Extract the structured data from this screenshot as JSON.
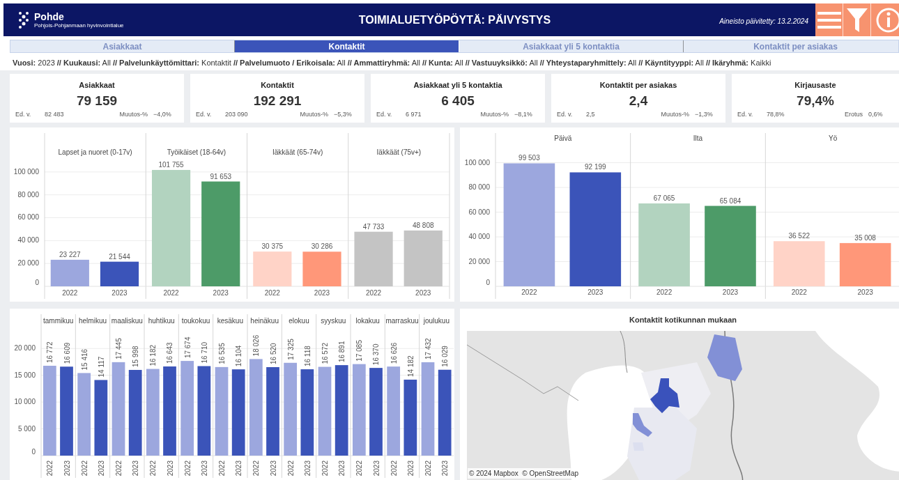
{
  "header": {
    "logo_text": "Pohde",
    "logo_subtitle": "Pohjois-Pohjanmaan hyvinvointialue",
    "title": "TOIMIALUETYÖPÖYTÄ: PÄIVYSTYS",
    "updated": "Aineisto päivitetty: 13.2.2024"
  },
  "tabs": [
    {
      "label": "Asiakkaat",
      "selected": false
    },
    {
      "label": "Kontaktit",
      "selected": true
    },
    {
      "label": "Asiakkaat yli 5 kontaktia",
      "selected": false
    },
    {
      "label": "Kontaktit per asiakas",
      "selected": false
    }
  ],
  "filters": "**Vuosi:** 2023 **// Kuukausi:** All **// Palvelunkäyttömittari:** Kontaktit **// Palvelumuoto / Erikoisala:** All **// Ammattiryhmä:** All **// Kunta:** All **// Vastuuyksikkö:** All **// Yhteystaparyhmittely:** All **// Käyntityyppi:** All **// Ikäryhmä:** Kaikki",
  "kpis": [
    {
      "title": "Asiakkaat",
      "value": "79 159",
      "prev_label": "Ed. v.",
      "prev_value": "82 483",
      "change_label": "Muutos-%",
      "change_value": "−4,0%"
    },
    {
      "title": "Kontaktit",
      "value": "192 291",
      "prev_label": "Ed. v.",
      "prev_value": "203 090",
      "change_label": "Muutos-%",
      "change_value": "−5,3%"
    },
    {
      "title": "Asiakkaat yli 5 kontaktia",
      "value": "6 405",
      "prev_label": "Ed. v.",
      "prev_value": "6 971",
      "change_label": "Muutos-%",
      "change_value": "−8,1%"
    },
    {
      "title": "Kontaktit per asiakas",
      "value": "2,4",
      "prev_label": "Ed. v.",
      "prev_value": "2,5",
      "change_label": "Muutos-%",
      "change_value": "−1,3%"
    },
    {
      "title": "Kirjausaste",
      "value": "79,4%",
      "prev_label": "Ed. v.",
      "prev_value": "78,8%",
      "change_label": "Erotus",
      "change_value": "0,6%"
    }
  ],
  "age_chart": {
    "chart_data": {
      "type": "bar",
      "categories": [
        "Lapset ja nuoret (0-17v)",
        "Työikäiset (18-64v)",
        "Iäkkäät (65-74v)",
        "Iäkkäät (75v+)"
      ],
      "series": [
        {
          "name": "2022",
          "colors": [
            "#9ca7de",
            "#b2d3bf",
            "#ffd3c7",
            "#c4c4c4"
          ],
          "values": [
            23227,
            101755,
            30375,
            47733
          ]
        },
        {
          "name": "2023",
          "colors": [
            "#3b54b9",
            "#4d9b68",
            "#ff9779",
            "#c4c4c4"
          ],
          "values": [
            21544,
            91653,
            30286,
            48808
          ]
        }
      ],
      "grid": true,
      "ylim": [
        0,
        134000
      ],
      "yticks": [
        {
          "value": 0,
          "label": "0"
        },
        {
          "value": 20000,
          "label": "20 000"
        },
        {
          "value": 40000,
          "label": "40 000"
        },
        {
          "value": 60000,
          "label": "60 000"
        },
        {
          "value": 80000,
          "label": "80 000"
        },
        {
          "value": 100000,
          "label": "100 000"
        }
      ],
      "data_labels": true
    }
  },
  "time_chart": {
    "chart_data": {
      "type": "bar",
      "categories": [
        "Päivä",
        "Ilta",
        "Yö"
      ],
      "series": [
        {
          "name": "2022",
          "colors": [
            "#9ca7de",
            "#b2d3bf",
            "#ffd3c7"
          ],
          "values": [
            99503,
            67065,
            36522
          ]
        },
        {
          "name": "2023",
          "colors": [
            "#3b54b9",
            "#4d9b68",
            "#ff9779"
          ],
          "values": [
            92199,
            65084,
            35008
          ]
        }
      ],
      "grid": true,
      "ylim": [
        0,
        124000
      ],
      "yticks": [
        {
          "value": 0,
          "label": "0"
        },
        {
          "value": 20000,
          "label": "20 000"
        },
        {
          "value": 40000,
          "label": "40 000"
        },
        {
          "value": 60000,
          "label": "60 000"
        },
        {
          "value": 80000,
          "label": "80 000"
        },
        {
          "value": 100000,
          "label": "100 000"
        }
      ],
      "data_labels": true
    }
  },
  "month_chart": {
    "chart_data": {
      "type": "bar",
      "categories": [
        "tammikuu",
        "helmikuu",
        "maaliskuu",
        "huhtikuu",
        "toukokuu",
        "kesäkuu",
        "heinäkuu",
        "elokuu",
        "syyskuu",
        "lokakuu",
        "marraskuu",
        "joulukuu"
      ],
      "series": [
        {
          "name": "2022",
          "color": "#9ca7de",
          "values": [
            16772,
            15416,
            17445,
            16182,
            17674,
            16535,
            18026,
            17325,
            16572,
            17085,
            16626,
            17432
          ]
        },
        {
          "name": "2023",
          "color": "#3b54b9",
          "values": [
            16609,
            14117,
            15998,
            16643,
            16710,
            16104,
            16520,
            16118,
            16891,
            16370,
            14182,
            16029
          ]
        }
      ],
      "grid": true,
      "ylim": [
        0,
        26400
      ],
      "yticks": [
        {
          "value": 0,
          "label": "0"
        },
        {
          "value": 5000,
          "label": "5 000"
        },
        {
          "value": 10000,
          "label": "10 000"
        },
        {
          "value": 15000,
          "label": "15 000"
        },
        {
          "value": 20000,
          "label": "20 000"
        }
      ],
      "data_labels": true
    }
  },
  "map": {
    "title": "Kontaktit kotikunnan mukaan",
    "attribution": "© 2024 Mapbox  © OpenStreetMap"
  }
}
